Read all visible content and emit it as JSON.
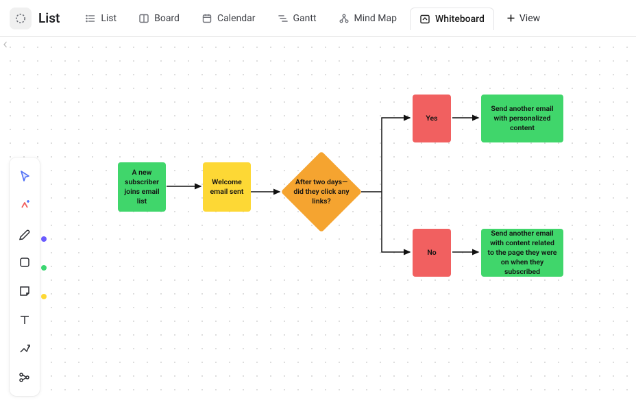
{
  "title": "List",
  "tabs": {
    "list": "List",
    "board": "Board",
    "calendar": "Calendar",
    "gantt": "Gantt",
    "mindmap": "Mind Map",
    "whiteboard": "Whiteboard",
    "addview": "View"
  },
  "toolbar_swatches": {
    "purple": "#6a5bff",
    "green": "#3bd671",
    "yellow": "#fdd835"
  },
  "flow": {
    "start": "A new subscriber joins email list",
    "welcome": "Welcome email sent",
    "decision": "After two days—did they click any links?",
    "yes": "Yes",
    "no": "No",
    "yes_action": "Send another email with personalized content",
    "no_action": "Send another email with content related to the page they were on when they subscribed"
  }
}
